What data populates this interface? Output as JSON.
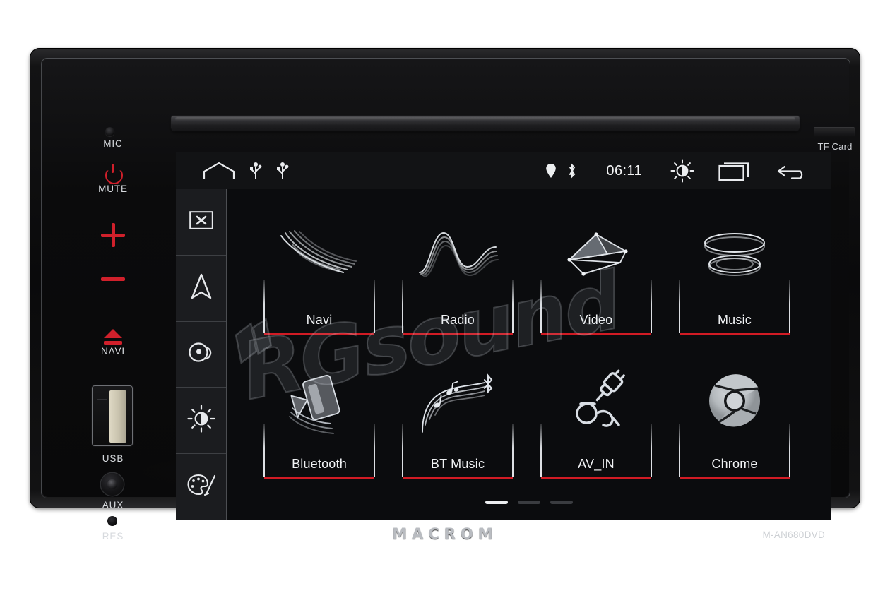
{
  "device": {
    "brand": "MACROM",
    "model": "M-AN680DVD",
    "tf_card_label": "TF Card",
    "watermark": "RGsound"
  },
  "hardware_buttons": [
    {
      "id": "mic",
      "label": "MIC",
      "icon": "microphone-hole-icon",
      "color": "#d7dade"
    },
    {
      "id": "mute",
      "label": "MUTE",
      "icon": "power-icon",
      "color": "#cf1f2a"
    },
    {
      "id": "volume-up",
      "label": "",
      "icon": "plus-icon",
      "color": "#d0202b"
    },
    {
      "id": "volume-down",
      "label": "",
      "icon": "minus-icon",
      "color": "#d0202b"
    },
    {
      "id": "navi",
      "label": "NAVI",
      "icon": "eject-icon",
      "color": "#d0202b"
    },
    {
      "id": "usb",
      "label": "USB",
      "icon": "usb-port-icon",
      "color": "#d7dade"
    },
    {
      "id": "aux",
      "label": "AUX",
      "icon": "aux-jack-icon",
      "color": "#d7dade"
    },
    {
      "id": "res",
      "label": "RES",
      "icon": "reset-pinhole-icon",
      "color": "#d7dade"
    }
  ],
  "statusbar": {
    "time": "06:11",
    "left_icons": [
      {
        "name": "home-icon"
      },
      {
        "name": "usb-icon"
      },
      {
        "name": "usb-icon"
      }
    ],
    "right_icons": [
      {
        "name": "location-pin-icon"
      },
      {
        "name": "bluetooth-icon"
      },
      {
        "name": "brightness-icon"
      },
      {
        "name": "recents-icon"
      },
      {
        "name": "back-icon"
      }
    ]
  },
  "rail": {
    "items": [
      {
        "name": "close-icon"
      },
      {
        "name": "navigation-arrow-icon"
      },
      {
        "name": "disc-icon"
      },
      {
        "name": "brightness-icon"
      },
      {
        "name": "palette-icon"
      }
    ]
  },
  "apps": [
    {
      "label": "Navi",
      "icon": "navi-swoosh-icon"
    },
    {
      "label": "Radio",
      "icon": "radio-wave-icon"
    },
    {
      "label": "Video",
      "icon": "video-prism-icon"
    },
    {
      "label": "Music",
      "icon": "music-disc-icon"
    },
    {
      "label": "Bluetooth",
      "icon": "bluetooth-speaker-icon"
    },
    {
      "label": "BT Music",
      "icon": "bt-music-notes-icon"
    },
    {
      "label": "AV_IN",
      "icon": "av-cable-icon"
    },
    {
      "label": "Chrome",
      "icon": "chrome-icon"
    }
  ],
  "pagination": {
    "pages": 3,
    "active_page": 1
  },
  "colors": {
    "accent_red": "#d11b24",
    "button_red": "#cf1f2a",
    "screen_bg": "#0b0c0e",
    "statusbar_bg": "#121315",
    "rail_bg": "#1b1c1f",
    "text": "#f0f2f4"
  }
}
